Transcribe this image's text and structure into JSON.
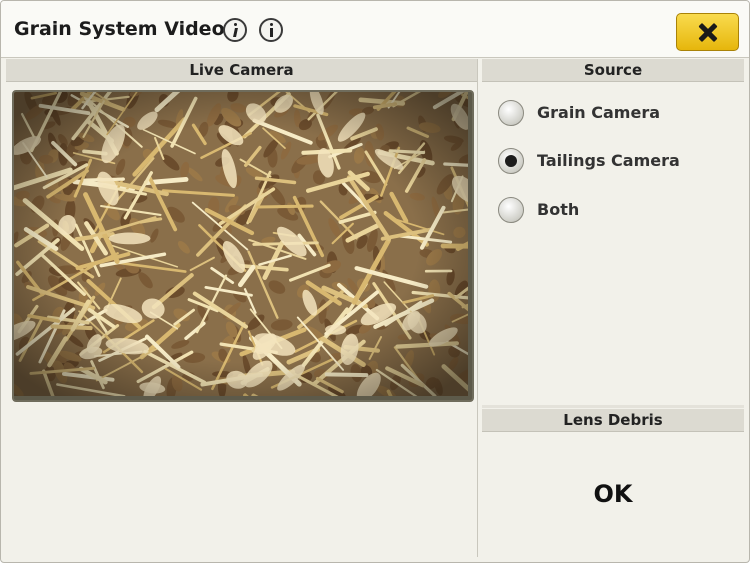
{
  "window": {
    "title": "Grain System Video"
  },
  "titlebar": {
    "info_icon_1": "info-icon",
    "info_icon_2": "info-icon",
    "close_icon": "close-icon",
    "close_color": "#f3c624"
  },
  "live_camera": {
    "header": "Live Camera"
  },
  "source": {
    "header": "Source",
    "options": [
      {
        "label": "Grain Camera",
        "selected": false
      },
      {
        "label": "Tailings Camera",
        "selected": true
      },
      {
        "label": "Both",
        "selected": false
      }
    ]
  },
  "lens_debris": {
    "header": "Lens Debris",
    "button_label": "OK"
  }
}
